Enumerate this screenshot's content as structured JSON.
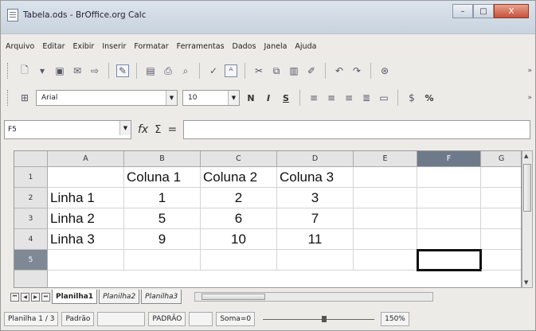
{
  "window": {
    "title": "Tabela.ods - BrOffice.org Calc",
    "min_glyph": "–",
    "max_glyph": "□",
    "close_glyph": "X"
  },
  "menu": [
    "Arquivo",
    "Editar",
    "Exibir",
    "Inserir",
    "Formatar",
    "Ferramentas",
    "Dados",
    "Janela",
    "Ajuda"
  ],
  "toolbar_format": {
    "font": "Arial",
    "size": "10",
    "bold": "N",
    "italic": "I",
    "underline": "S",
    "percent": "%"
  },
  "formula_bar": {
    "cell_ref": "F5",
    "fx": "fx",
    "sigma": "Σ",
    "equals": "=",
    "content": ""
  },
  "grid": {
    "columns": [
      "A",
      "B",
      "C",
      "D",
      "E",
      "F",
      "G"
    ],
    "selected_column": "F",
    "rows": [
      {
        "num": "1",
        "cells": [
          "",
          "Coluna 1",
          "Coluna 2",
          "Coluna 3",
          "",
          "",
          ""
        ]
      },
      {
        "num": "2",
        "cells": [
          "Linha 1",
          "1",
          "2",
          "3",
          "",
          "",
          ""
        ]
      },
      {
        "num": "3",
        "cells": [
          "Linha 2",
          "5",
          "6",
          "7",
          "",
          "",
          ""
        ]
      },
      {
        "num": "4",
        "cells": [
          "Linha 3",
          "9",
          "10",
          "11",
          "",
          "",
          ""
        ]
      },
      {
        "num": "5",
        "cells": [
          "",
          "",
          "",
          "",
          "",
          "",
          ""
        ]
      }
    ],
    "selected_row": "5",
    "active_cell": "F5"
  },
  "sheets": {
    "tabs": [
      "Planilha1",
      "Planilha2",
      "Planilha3"
    ],
    "active": "Planilha1"
  },
  "status": {
    "sheet": "Planilha 1 / 3",
    "style": "Padrão",
    "mode": "PADRÃO",
    "sum": "Soma=0",
    "zoom": "150%"
  }
}
